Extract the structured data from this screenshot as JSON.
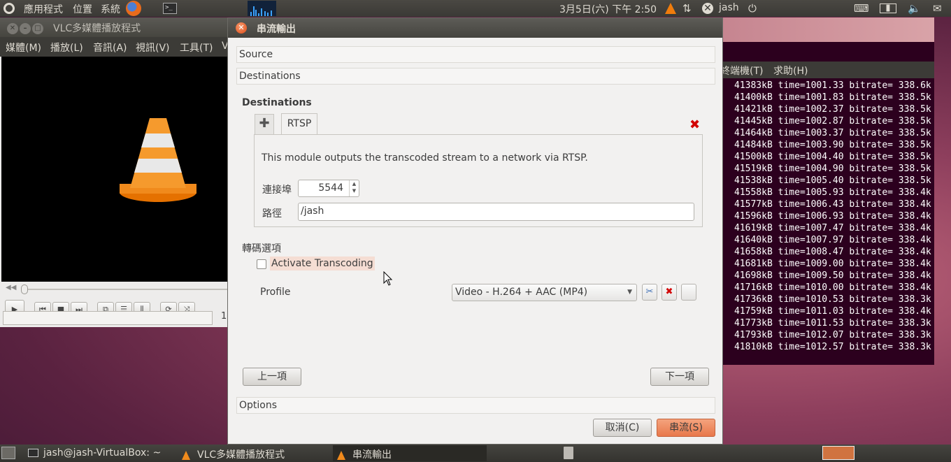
{
  "top_panel": {
    "apps_menu": "應用程式",
    "places_menu": "位置",
    "system_menu": "系統",
    "clock": "3月5日(六) 下午 2:50",
    "user": "jash"
  },
  "vlc": {
    "title": "VLC多媒體播放程式",
    "menu": [
      "媒體(M)",
      "播放(L)",
      "音訊(A)",
      "視訊(V)",
      "工具(T)",
      "V"
    ],
    "time": "1."
  },
  "terminal": {
    "menu": [
      "終端機(T)",
      "求助(H)"
    ],
    "lines": [
      "41383kB time=1001.33 bitrate= 338.6k",
      "41400kB time=1001.83 bitrate= 338.5k",
      "41421kB time=1002.37 bitrate= 338.5k",
      "41445kB time=1002.87 bitrate= 338.5k",
      "41464kB time=1003.37 bitrate= 338.5k",
      "41484kB time=1003.90 bitrate= 338.5k",
      "41500kB time=1004.40 bitrate= 338.5k",
      "41519kB time=1004.90 bitrate= 338.5k",
      "41538kB time=1005.40 bitrate= 338.5k",
      "41558kB time=1005.93 bitrate= 338.4k",
      "41577kB time=1006.43 bitrate= 338.4k",
      "41596kB time=1006.93 bitrate= 338.4k",
      "41619kB time=1007.47 bitrate= 338.4k",
      "41640kB time=1007.97 bitrate= 338.4k",
      "41658kB time=1008.47 bitrate= 338.4k",
      "41681kB time=1009.00 bitrate= 338.4k",
      "41698kB time=1009.50 bitrate= 338.4k",
      "41716kB time=1010.00 bitrate= 338.4k",
      "41736kB time=1010.53 bitrate= 338.3k",
      "41759kB time=1011.03 bitrate= 338.4k",
      "41773kB time=1011.53 bitrate= 338.3k",
      "41793kB time=1012.07 bitrate= 338.3k",
      "41810kB time=1012.57 bitrate= 338.3k"
    ]
  },
  "dialog": {
    "title": "串流輸出",
    "source_section": "Source",
    "destinations_section": "Destinations",
    "destinations_heading": "Destinations",
    "tab_label": "RTSP",
    "module_description": "This module outputs the transcoded stream to a network via RTSP.",
    "port_label": "連接埠",
    "port_value": "5544",
    "path_label": "路徑",
    "path_value": "/jash",
    "transcode_heading": "轉碼選項",
    "transcode_checkbox_label": "Activate Transcoding",
    "transcode_checked": false,
    "profile_label": "Profile",
    "profile_selected": "Video - H.264 + AAC (MP4)",
    "prev_button": "上一項",
    "next_button": "下一項",
    "options_section": "Options",
    "cancel_button": "取消(C)",
    "stream_button": "串流(S)"
  },
  "taskbar": {
    "items": [
      "jash@jash-VirtualBox: ~",
      "VLC多媒體播放程式",
      "串流輸出"
    ]
  },
  "colors": {
    "accent": "#e8784b",
    "terminal_bg": "#2c001e",
    "panel_bg": "#3c3b37"
  }
}
